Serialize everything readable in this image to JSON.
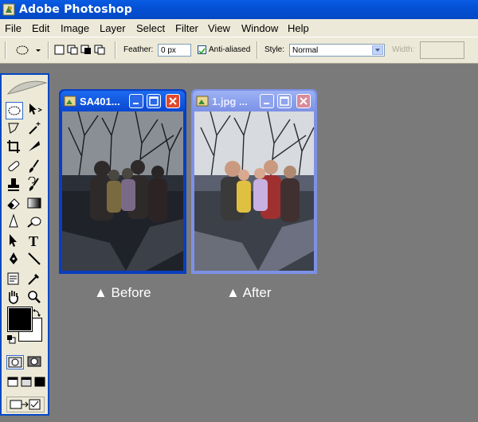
{
  "window": {
    "title": "Adobe Photoshop"
  },
  "menu": [
    "File",
    "Edit",
    "Image",
    "Layer",
    "Select",
    "Filter",
    "View",
    "Window",
    "Help"
  ],
  "options": {
    "feather_label": "Feather:",
    "feather_value": "0 px",
    "anti_aliased_label": "Anti-aliased",
    "anti_aliased_checked": true,
    "style_label": "Style:",
    "style_value": "Normal",
    "width_label": "Width:"
  },
  "documents": [
    {
      "title": "SA401...",
      "state": "active"
    },
    {
      "title": "1.jpg ...",
      "state": "inactive"
    }
  ],
  "captions": {
    "before": "▲ Before",
    "after": "▲ After"
  },
  "colors": {
    "titlebar": "#0451d6",
    "workspace": "#7a7a7a",
    "chrome": "#ece9d8",
    "close_button": "#e04a2c"
  },
  "icons": [
    "marquee-icon",
    "move-icon",
    "lasso-icon",
    "magic-wand-icon",
    "crop-icon",
    "slice-icon",
    "healing-icon",
    "brush-icon",
    "stamp-icon",
    "history-brush-icon",
    "eraser-icon",
    "gradient-icon",
    "blur-icon",
    "dodge-icon",
    "path-select-icon",
    "type-icon",
    "pen-icon",
    "line-icon",
    "notes-icon",
    "eyedropper-icon",
    "hand-icon",
    "zoom-icon"
  ]
}
